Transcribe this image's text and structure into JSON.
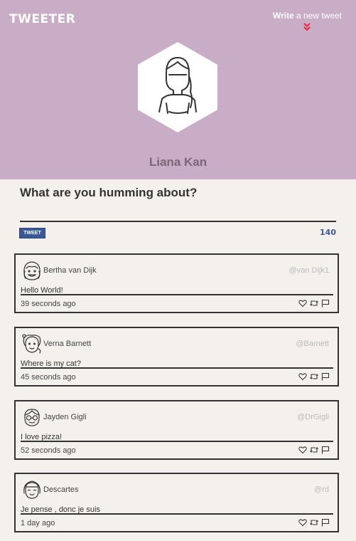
{
  "app": {
    "logo": "TWEETER"
  },
  "compose_link": {
    "bold": "Write",
    "rest": " a new tweet"
  },
  "profile": {
    "name": "Liana Kan",
    "avatar_icon": "user-avatar-icon"
  },
  "composer": {
    "question": "What are you humming about?",
    "button_label": "TWEET",
    "counter": "140"
  },
  "colors": {
    "header_bg": "#c9adc6",
    "page_bg": "#f4f1ec",
    "button_bg": "#3b5998",
    "chevron": "#e8243a"
  },
  "tweets": [
    {
      "name": "Bertha van Dijk",
      "handle": "@van Dijk1",
      "text": "Hello World!",
      "time": "39 seconds ago"
    },
    {
      "name": "Verna Barnett",
      "handle": "@Barnett",
      "text": "Where is my cat?",
      "time": "45 seconds ago"
    },
    {
      "name": "Jayden Gigli",
      "handle": "@DrGigli",
      "text": "I love pizza!",
      "time": "52 seconds ago"
    },
    {
      "name": "Descartes",
      "handle": "@rd",
      "text": "Je pense , donc je suis",
      "time": "1 day ago"
    }
  ]
}
